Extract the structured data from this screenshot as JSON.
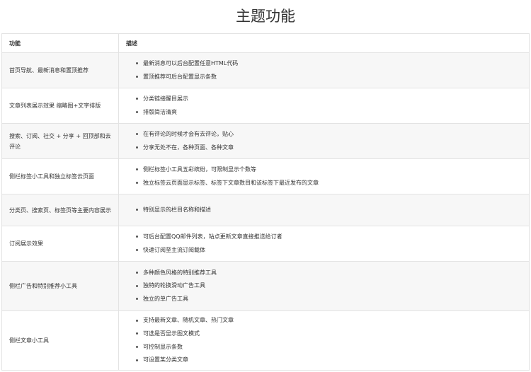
{
  "title": "主题功能",
  "table": {
    "headers": [
      "功能",
      "描述"
    ],
    "rows": [
      {
        "feature": "首页导航、最新消息和置顶推荐",
        "items": [
          "最新消息可以后台配置任意HTML代码",
          "置顶推荐可后台配置显示条数"
        ]
      },
      {
        "feature": "文章列表展示效果 缩略图+文字排版",
        "items": [
          "分类链接醒目展示",
          "排版简洁清爽"
        ]
      },
      {
        "feature": "搜索、订阅、社交 + 分享 + 回顶部和去评论",
        "items": [
          "在有评论的时候才会有去评论，贴心",
          "分享无处不在，各种页面、各种文章"
        ]
      },
      {
        "feature": "侧栏标签小工具和独立标签云页面",
        "items": [
          "侧栏标签小工具五彩缤纷，可限制显示个数等",
          "独立标签云页面显示标签、标签下文章数目和该标签下最近发布的文章"
        ]
      },
      {
        "feature": "分类页、搜索页、标签页等主要内容展示",
        "items": [
          "特别显示的栏目名称和描述"
        ]
      },
      {
        "feature": "订阅展示效果",
        "items": [
          "可后台配置QQ邮件列表，站点更新文章直接推送给订者",
          "快速订阅至主流订阅载体"
        ]
      },
      {
        "feature": "侧栏广告和特别推荐小工具",
        "items": [
          "多种颜色风格的特别推荐工具",
          "独特的轮换滑动广告工具",
          "独立的单广告工具"
        ]
      },
      {
        "feature": "侧栏文章小工具",
        "items": [
          "支持最新文章、随机文章、热门文章",
          "可选是否显示图文模式",
          "可控制显示条数",
          "可设置某分类文章"
        ]
      }
    ]
  }
}
